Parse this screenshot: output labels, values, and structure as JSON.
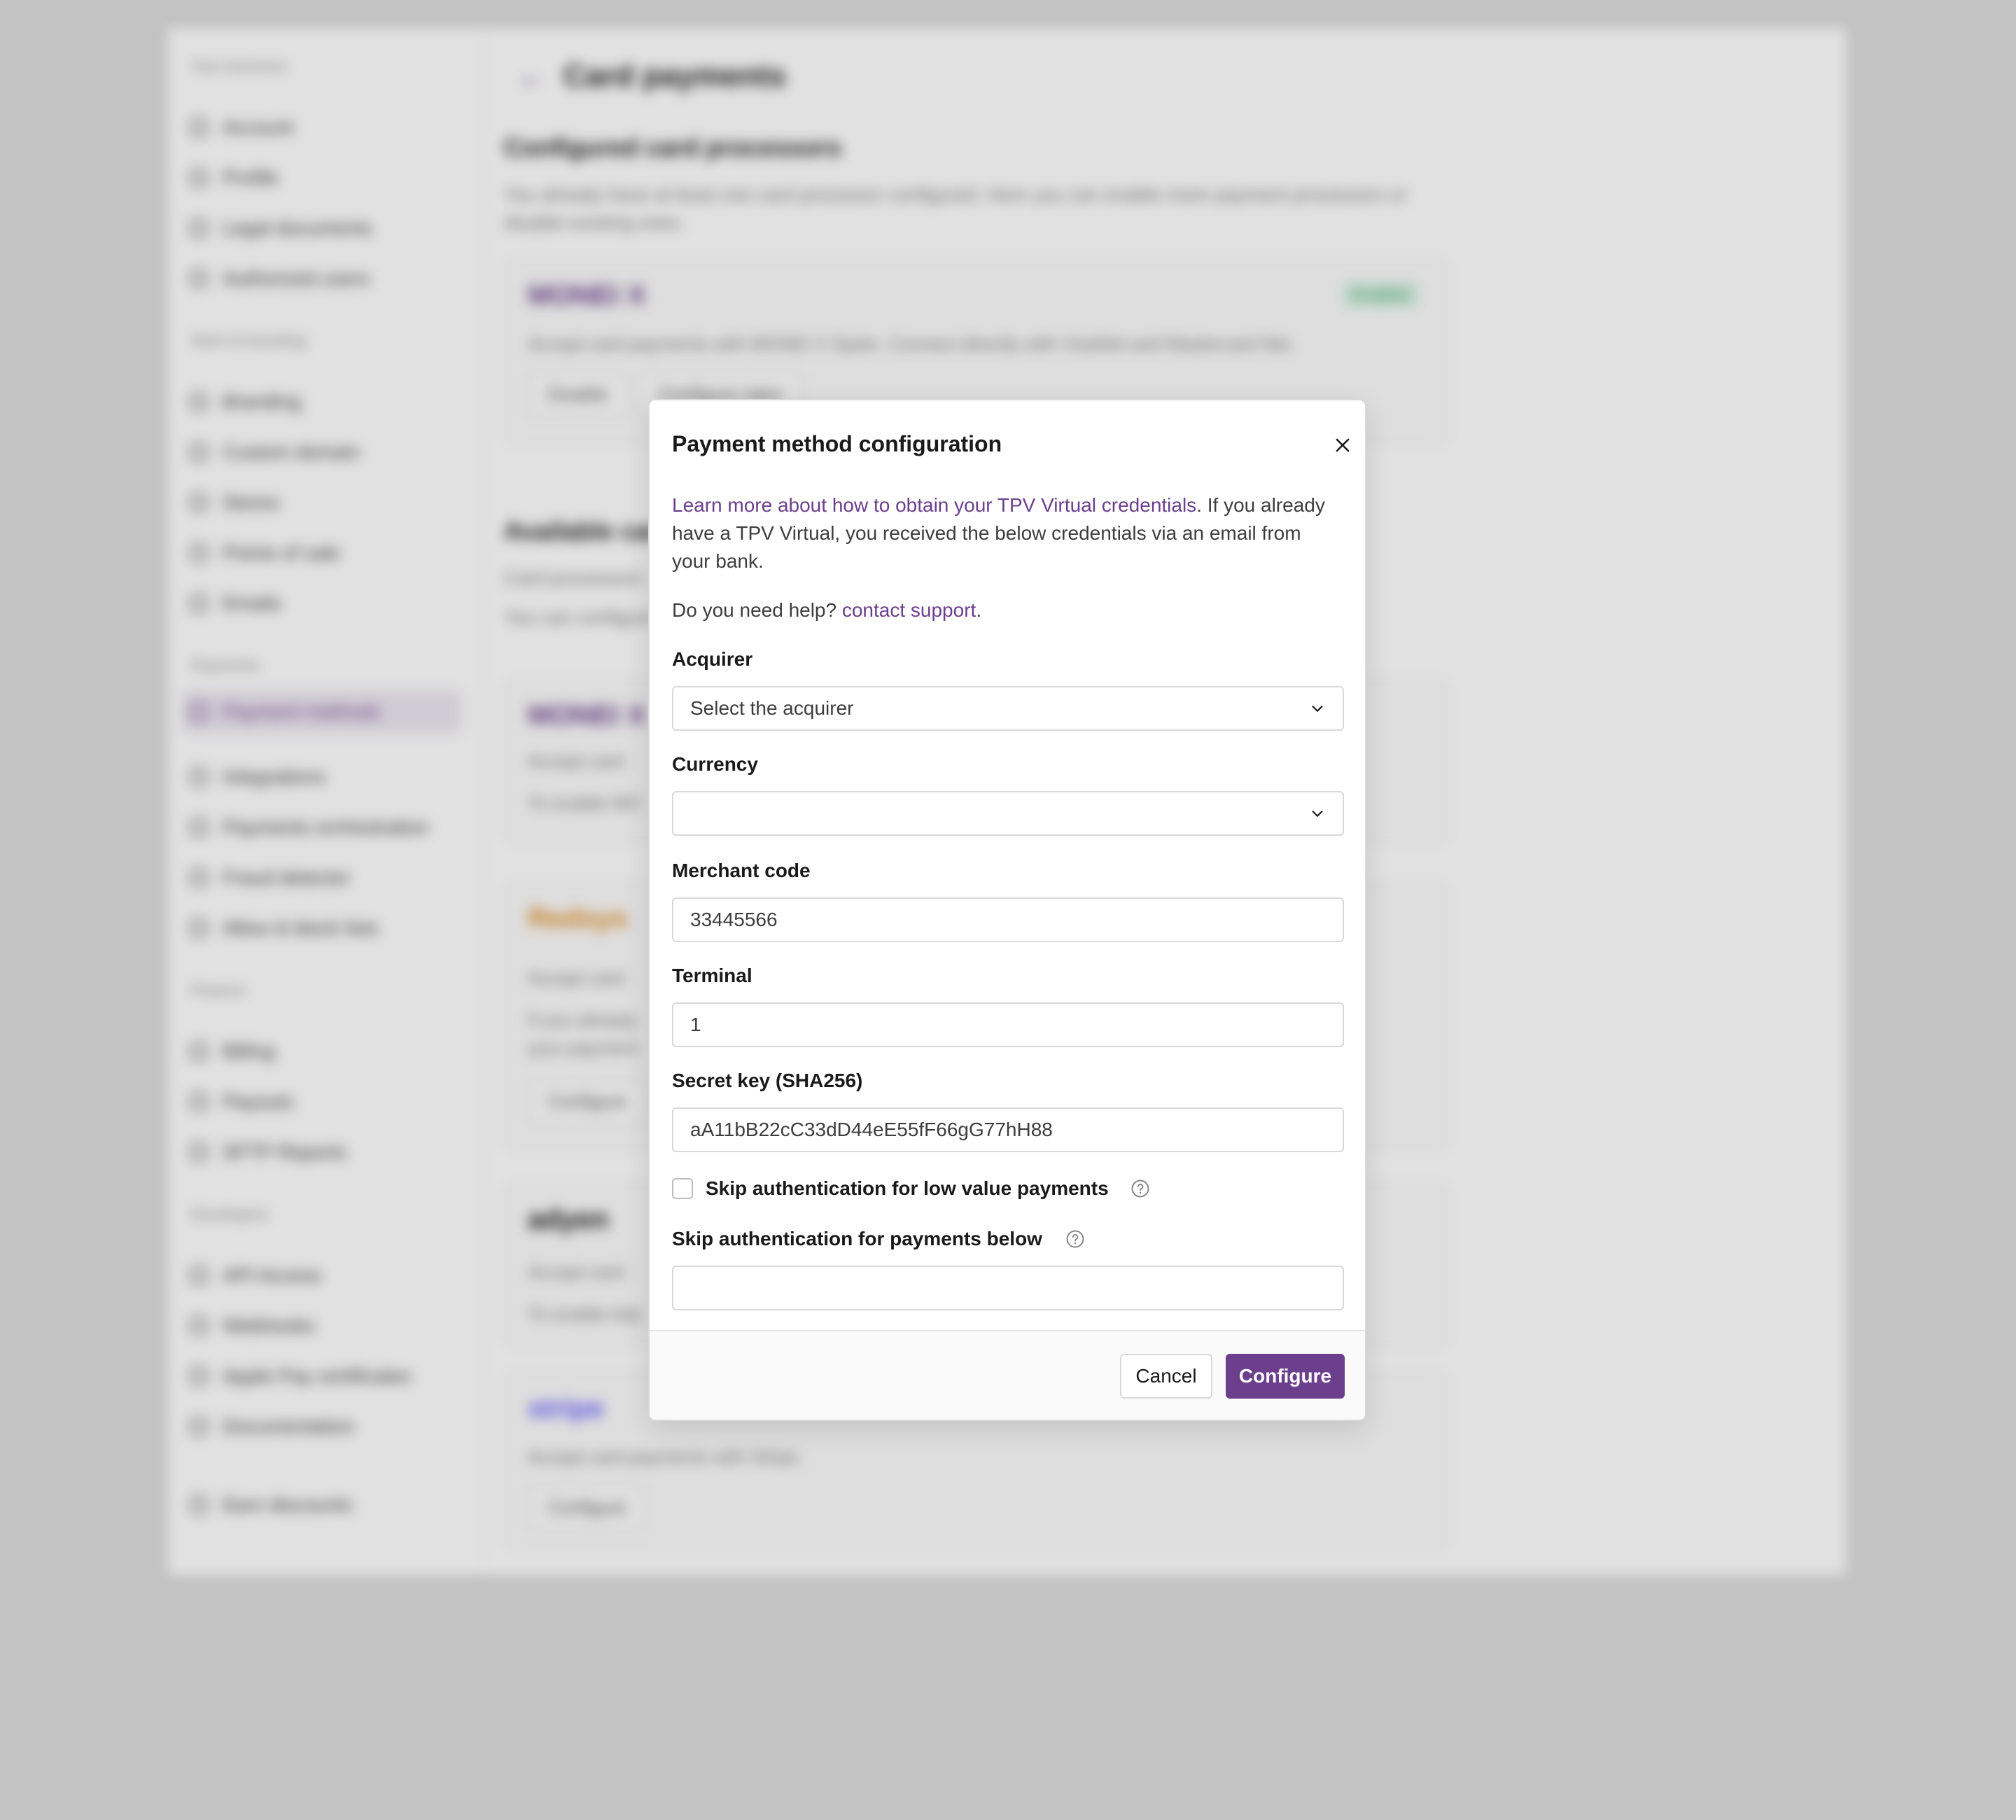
{
  "background": {
    "sidebar": {
      "sections": [
        {
          "title": "Your business",
          "items": [
            "Account",
            "Profile",
            "Legal documents",
            "Authorized users"
          ]
        },
        {
          "title": "Store & branding",
          "items": [
            "Branding",
            "Custom domain",
            "Stores",
            "Points of sale",
            "Emails"
          ]
        },
        {
          "title": "Payments",
          "items": [
            "Payment methods",
            "Integrations",
            "Payments orchestration",
            "Fraud detector",
            "Allow & block lists"
          ]
        },
        {
          "title": "Finance",
          "items": [
            "Billing",
            "Payouts",
            "SFTP Reports"
          ]
        },
        {
          "title": "Developers",
          "items": [
            "API Access",
            "Webhooks",
            "Apple Pay certificates",
            "Documentation"
          ]
        }
      ],
      "bottom_item": "Earn discounts"
    },
    "main": {
      "back_glyph": "←",
      "title": "Card payments",
      "configured_heading": "Configured card processors",
      "configured_text": "You already have at least one card processor configured. Here you can enable more payment processors or disable existing ones.",
      "monei_card": {
        "logo": "MONEI X",
        "badge": "Enabled",
        "text": "Accept card payments with MONEI X Spain. Connect directly with VisaNet and Mastercard Net.",
        "btn_disable": "Disable",
        "btn_rates": "Configure rates"
      },
      "available_heading": "Available card processors",
      "available_text_1": "Card processors",
      "available_text_2": "You can configure",
      "monei_card_2": {
        "logo": "MONEI X",
        "text": "Accept card",
        "text2": "To enable MO"
      },
      "redsys_card": {
        "logo": "Redsys",
        "text": "Accept card",
        "text2": "If you already",
        "text3": "your payment",
        "btn": "Configure"
      },
      "adyen_card": {
        "logo": "adyen",
        "text": "Accept card",
        "text2": "To enable Ady"
      },
      "stripe_card": {
        "logo": "stripe",
        "text": "Accept card payments with Stripe.",
        "btn": "Configure"
      }
    }
  },
  "modal": {
    "title": "Payment method configuration",
    "intro_link": "Learn more about how to obtain your TPV Virtual credentials",
    "intro_text": ". If you already have a TPV Virtual, you received the below credentials via an email from your bank.",
    "help_text": "Do you need help? ",
    "help_link": "contact support",
    "help_end": ".",
    "fields": {
      "acquirer": {
        "label": "Acquirer",
        "value": "Select the acquirer"
      },
      "currency": {
        "label": "Currency",
        "value": ""
      },
      "merchant_code": {
        "label": "Merchant code",
        "value": "33445566"
      },
      "terminal": {
        "label": "Terminal",
        "value": "1"
      },
      "secret_key": {
        "label": "Secret key (SHA256)",
        "value": "aA11bB22cC33dD44eE55fF66gG77hH88"
      },
      "skip_low_value": {
        "label": "Skip authentication for low value payments",
        "checked": false
      },
      "skip_below": {
        "label": "Skip authentication for payments below",
        "value": ""
      }
    },
    "buttons": {
      "cancel": "Cancel",
      "configure": "Configure"
    }
  },
  "colors": {
    "accent": "#6b3f8c",
    "enabled_badge": "#2a9a5a",
    "overlay": "#dcdcdc"
  },
  "icons": [
    "close-icon",
    "chevron-down-icon",
    "help-circle-icon"
  ]
}
